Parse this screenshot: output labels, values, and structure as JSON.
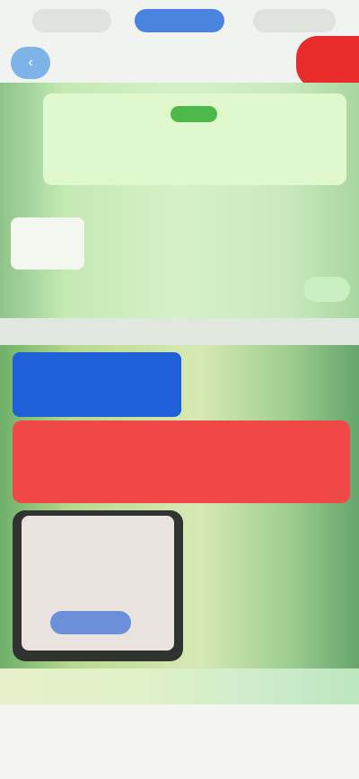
{
  "nav": {
    "tabs": [
      {
        "label": ""
      },
      {
        "label": ""
      },
      {
        "label": ""
      }
    ],
    "subtitle": "",
    "left_button_icon": "back-icon",
    "right_button_label": ""
  },
  "hero": {
    "pill_label": "",
    "card_text": "",
    "caption": "",
    "foot_text": ""
  },
  "promo": {
    "blue_label": "",
    "red_label": "",
    "phone_button_label": ""
  },
  "bottom": {
    "text": ""
  },
  "colors": {
    "accent_blue": "#1f5fd8",
    "accent_red": "#f04747",
    "accent_green": "#4fb84a"
  }
}
